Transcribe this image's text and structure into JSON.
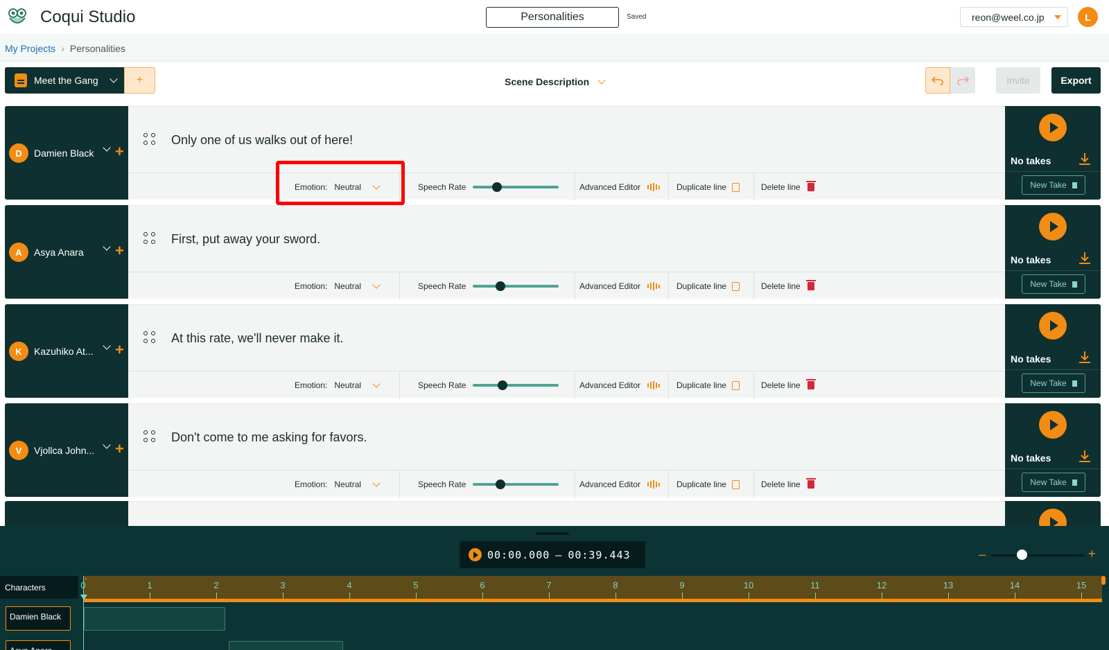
{
  "app": {
    "title": "Coqui Studio",
    "project_name": "Personalities",
    "save_status": "Saved",
    "user_email": "reon@weel.co.jp",
    "user_initial": "L",
    "brand_color": "#f28c14",
    "dark_color": "#0f3030"
  },
  "breadcrumb": {
    "root": "My Projects",
    "current": "Personalities"
  },
  "toolbar": {
    "scene_name": "Meet the Gang",
    "add_scene": "+",
    "scene_description": "Scene Description",
    "invite": "Invite",
    "export": "Export"
  },
  "lines": [
    {
      "initial": "D",
      "character": "Damien Black",
      "text": "Only one of us walks out of here!",
      "emotion_label": "Emotion:",
      "emotion": "Neutral",
      "speech_rate_label": "Speech Rate",
      "speech_rate": 0.28,
      "advanced": "Advanced Editor",
      "duplicate": "Duplicate line",
      "delete": "Delete line",
      "takes": "No takes",
      "new_take": "New Take"
    },
    {
      "initial": "A",
      "character": "Asya Anara",
      "text": "First, put away your sword.",
      "emotion_label": "Emotion:",
      "emotion": "Neutral",
      "speech_rate_label": "Speech Rate",
      "speech_rate": 0.32,
      "advanced": "Advanced Editor",
      "duplicate": "Duplicate line",
      "delete": "Delete line",
      "takes": "No takes",
      "new_take": "New Take"
    },
    {
      "initial": "K",
      "character": "Kazuhiko At...",
      "text": "At this rate, we'll never make it.",
      "emotion_label": "Emotion:",
      "emotion": "Neutral",
      "speech_rate_label": "Speech Rate",
      "speech_rate": 0.35,
      "advanced": "Advanced Editor",
      "duplicate": "Duplicate line",
      "delete": "Delete line",
      "takes": "No takes",
      "new_take": "New Take"
    },
    {
      "initial": "V",
      "character": "Vjollca John...",
      "text": "Don't come to me asking for favors.",
      "emotion_label": "Emotion:",
      "emotion": "Neutral",
      "speech_rate_label": "Speech Rate",
      "speech_rate": 0.32,
      "advanced": "Advanced Editor",
      "duplicate": "Duplicate line",
      "delete": "Delete line",
      "takes": "No takes",
      "new_take": "New Take"
    }
  ],
  "timeline": {
    "time_start": "00:00.000",
    "time_separator": "–",
    "time_end": "00:39.443",
    "zoom_minus": "–",
    "zoom_plus": "+",
    "zoom_level": 0.33,
    "characters_label": "Characters",
    "ruler_ticks": [
      "0",
      "1",
      "2",
      "3",
      "4",
      "5",
      "6",
      "7",
      "8",
      "9",
      "10",
      "11",
      "12",
      "13",
      "14",
      "15"
    ],
    "tracks": [
      {
        "name": "Damien Black",
        "clip_start": 0.0,
        "clip_end": 2.13
      },
      {
        "name": "Asya Anara",
        "clip_start": 2.18,
        "clip_end": 3.9
      }
    ]
  }
}
